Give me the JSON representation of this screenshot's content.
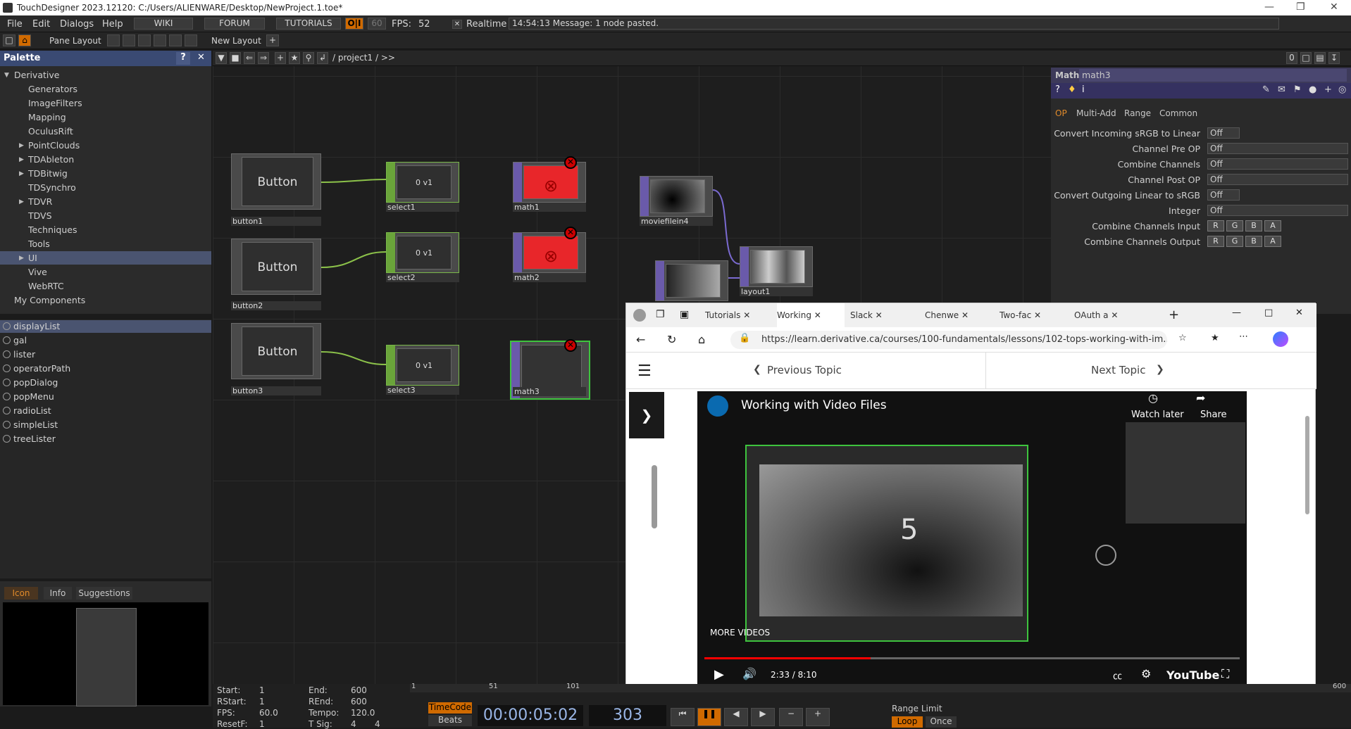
{
  "titlebar": {
    "title": "TouchDesigner 2023.12120: C:/Users/ALIENWARE/Desktop/NewProject.1.toe*"
  },
  "menubar": {
    "items": [
      "File",
      "Edit",
      "Dialogs",
      "Help"
    ],
    "wiki": "WIKI",
    "forum": "FORUM",
    "tutorials": "TUTORIALS",
    "fps_label": "FPS:",
    "fps_value": "52",
    "fps_cap": "60",
    "realtime": "Realtime",
    "message": "14:54:13 Message: 1 node pasted."
  },
  "toolbar2": {
    "pane_layout": "Pane Layout",
    "new_layout": "New Layout"
  },
  "palette": {
    "title": "Palette",
    "root": "Derivative",
    "items": [
      "Generators",
      "ImageFilters",
      "Mapping",
      "OculusRift",
      "PointClouds",
      "TDAbleton",
      "TDBitwig",
      "TDSynchro",
      "TDVR",
      "TDVS",
      "Techniques",
      "Tools",
      "UI",
      "Vive",
      "WebRTC"
    ],
    "my_components": "My Components"
  },
  "components": [
    "displayList",
    "gal",
    "lister",
    "operatorPath",
    "popDialog",
    "popMenu",
    "radioList",
    "simpleList",
    "treeLister"
  ],
  "icon_panel": {
    "tabs": [
      "Icon",
      "Info",
      "Suggestions"
    ]
  },
  "network": {
    "path": "/ project1 / >>",
    "nodes": {
      "button1": {
        "name": "button1",
        "label": "Button"
      },
      "button2": {
        "name": "button2",
        "label": "Button"
      },
      "button3": {
        "name": "button3",
        "label": "Button"
      },
      "select1": {
        "name": "select1",
        "value": "0 v1"
      },
      "select2": {
        "name": "select2",
        "value": "0 v1"
      },
      "select3": {
        "name": "select3",
        "value": "0 v1"
      },
      "math1": {
        "name": "math1"
      },
      "math2": {
        "name": "math2"
      },
      "math3": {
        "name": "math3"
      },
      "moviefilein4": {
        "name": "moviefilein4"
      },
      "layout1": {
        "name": "layout1"
      }
    }
  },
  "params": {
    "type": "Math",
    "name": "math3",
    "tabs": [
      "OP",
      "Multi-Add",
      "Range",
      "Common"
    ],
    "rows": [
      {
        "label": "Convert Incoming sRGB to Linear",
        "value": "Off"
      },
      {
        "label": "Channel Pre OP",
        "value": "Off"
      },
      {
        "label": "Combine Channels",
        "value": "Off"
      },
      {
        "label": "Channel Post OP",
        "value": "Off"
      },
      {
        "label": "Convert Outgoing Linear to sRGB",
        "value": "Off"
      },
      {
        "label": "Integer",
        "value": "Off"
      },
      {
        "label": "Combine Channels Input",
        "value": ""
      },
      {
        "label": "Combine Channels Output",
        "value": ""
      }
    ],
    "rgba": [
      "R",
      "G",
      "B",
      "A"
    ]
  },
  "browser": {
    "tabs": [
      "Tutorials",
      "Working",
      "Slack",
      "Chenwe",
      "Two-fac",
      "OAuth a"
    ],
    "url": "https://learn.derivative.ca/courses/100-fundamentals/lessons/102-tops-working-with-im...",
    "prev_topic": "Previous Topic",
    "next_topic": "Next Topic",
    "video": {
      "title": "Working with Video Files",
      "watch_later": "Watch later",
      "share": "Share",
      "more_videos": "MORE VIDEOS",
      "time": "2:33 / 8:10",
      "brand": "YouTube",
      "frame_number": "5",
      "progress": 0.31
    }
  },
  "timeline": {
    "start_label": "Start:",
    "start": "1",
    "end_label": "End:",
    "end": "600",
    "rstart_label": "RStart:",
    "rstart": "1",
    "rend_label": "REnd:",
    "rend": "600",
    "fps_label": "FPS:",
    "fps": "60.0",
    "tempo_label": "Tempo:",
    "tempo": "120.0",
    "resetf_label": "ResetF:",
    "resetf": "1",
    "tsig_label": "T Sig:",
    "tsig1": "4",
    "tsig2": "4",
    "ruler": [
      "1",
      "51",
      "101"
    ],
    "ruler_end": "600",
    "timecode_label": "TimeCode",
    "beats_label": "Beats",
    "timecode": "00:00:05:02",
    "frame": "303",
    "range_limit": "Range Limit",
    "loop": "Loop",
    "once": "Once"
  }
}
